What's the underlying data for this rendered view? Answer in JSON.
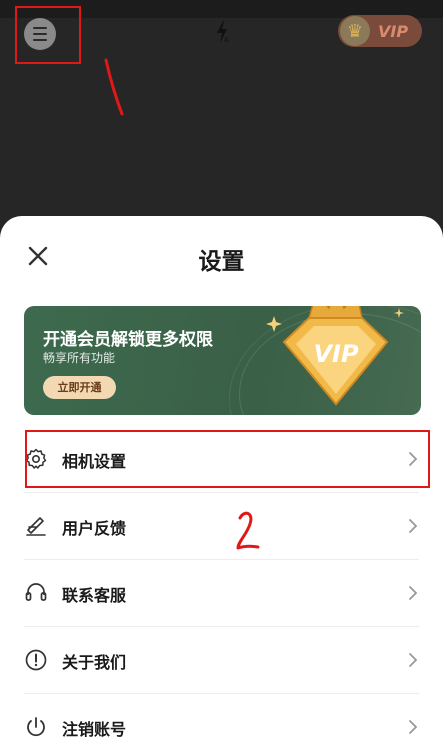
{
  "background": {
    "vip_badge_text": "VIP"
  },
  "sheet": {
    "title": "设置",
    "vip_banner": {
      "headline": "开通会员解锁更多权限",
      "subtitle": "畅享所有功能",
      "cta_label": "立即开通",
      "badge_text": "VIP"
    },
    "items": [
      {
        "label": "相机设置",
        "icon": "gear-icon"
      },
      {
        "label": "用户反馈",
        "icon": "feedback-pen-icon"
      },
      {
        "label": "联系客服",
        "icon": "headset-icon"
      },
      {
        "label": "关于我们",
        "icon": "info-exclamation-icon"
      },
      {
        "label": "注销账号",
        "icon": "power-icon"
      }
    ]
  },
  "annotations": {
    "top_mark": "1",
    "list_mark": "2"
  },
  "colors": {
    "banner_green": "#3d6a4e",
    "cta_bg": "#f3d9b3",
    "annotation_red": "#e01818"
  }
}
